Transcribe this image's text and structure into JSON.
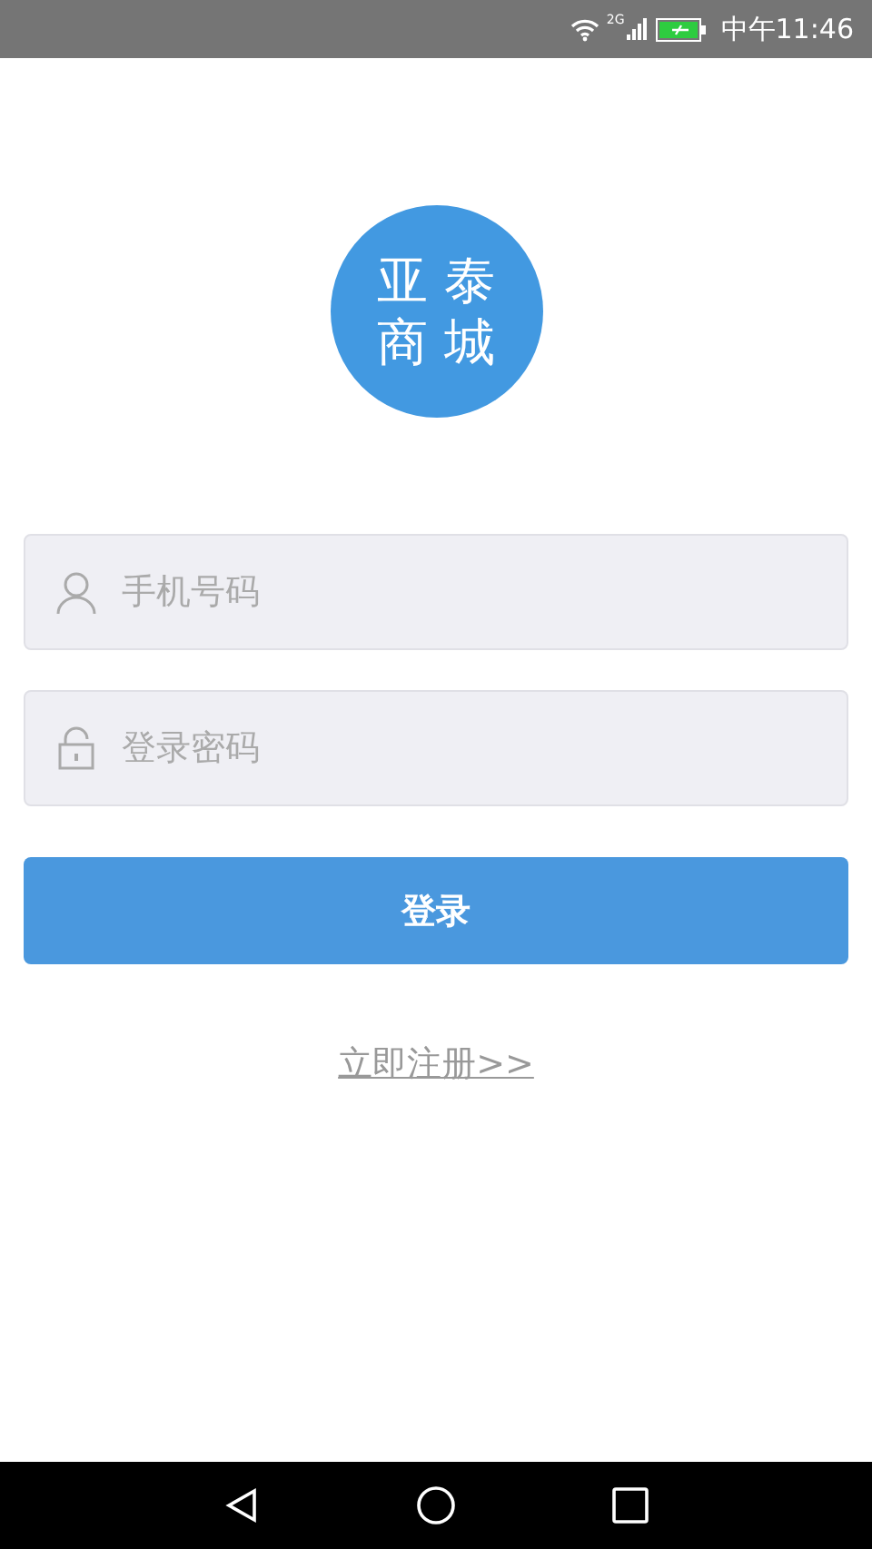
{
  "status_bar": {
    "network": "2G",
    "time": "中午11:46"
  },
  "logo": {
    "lines": [
      "亚 泰",
      "商 城"
    ]
  },
  "fields": [
    {
      "kind": "phone",
      "placeholder": "手机号码"
    },
    {
      "kind": "password",
      "placeholder": "登录密码"
    }
  ],
  "login_button": "登录",
  "register_link": "立即注册>>"
}
